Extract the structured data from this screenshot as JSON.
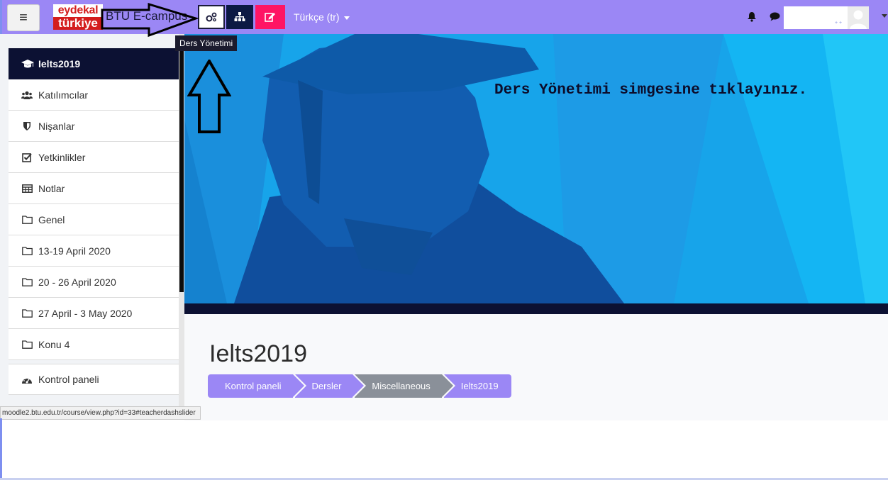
{
  "navbar": {
    "menu_icon": "hamburger-icon",
    "logo_line1": "eydekal",
    "logo_line2": "türkiye",
    "site_name": "BTU E-campus",
    "course_manage_icon": "cogs-icon",
    "course_tree_icon": "sitemap-icon",
    "edit_icon": "edit-icon",
    "language": "Türkçe (tr)",
    "user_tag": "+ +"
  },
  "tooltip": "Ders Yönetimi",
  "drawer": {
    "course": "Ielts2019",
    "items": [
      {
        "label": "Katılımcılar",
        "icon": "users-icon"
      },
      {
        "label": "Nişanlar",
        "icon": "shield-icon"
      },
      {
        "label": "Yetkinlikler",
        "icon": "check-square-icon"
      },
      {
        "label": "Notlar",
        "icon": "table-icon"
      },
      {
        "label": "Genel",
        "icon": "folder-icon"
      },
      {
        "label": "13-19 April 2020",
        "icon": "folder-icon"
      },
      {
        "label": "20 - 26 April 2020",
        "icon": "folder-icon"
      },
      {
        "label": "27 April - 3 May 2020",
        "icon": "folder-icon"
      },
      {
        "label": "Konu 4",
        "icon": "folder-icon"
      }
    ],
    "dashboard": "Kontrol paneli"
  },
  "banner": {
    "instruction": "Ders Yönetimi simgesine tıklayınız."
  },
  "main": {
    "title": "Ielts2019",
    "breadcrumb": [
      "Kontrol paneli",
      "Dersler",
      "Miscellaneous",
      "Ielts2019"
    ]
  },
  "status_url": "moodle2.btu.edu.tr/course/view.php?id=33#teacherdashslider",
  "colors": {
    "navbar": "#9b87f5",
    "accent_dark": "#0c1133",
    "edit_button": "#ff1464",
    "banner": "#1aa9ee"
  }
}
